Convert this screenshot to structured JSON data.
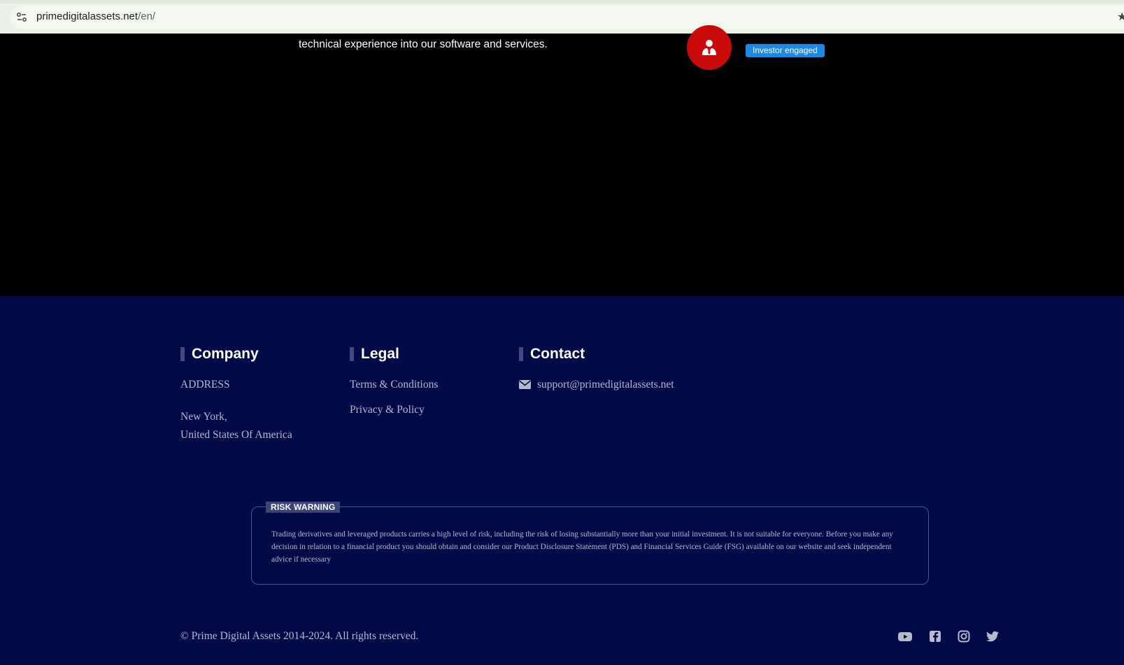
{
  "browser": {
    "url_domain": "primedigitalassets.net",
    "url_path": "/en/"
  },
  "hero": {
    "text": "technical experience into our software and services.",
    "badge": "Investor engaged",
    "avatar_icon": "user-tie-icon",
    "avatar_color": "#c80a0a",
    "badge_color": "#1e88e5"
  },
  "footer": {
    "background": "#000a46",
    "company": {
      "heading": "Company",
      "address_label": "ADDRESS",
      "address_line1": "New York,",
      "address_line2": "United States Of America"
    },
    "legal": {
      "heading": "Legal",
      "links": [
        "Terms & Conditions",
        "Privacy & Policy"
      ]
    },
    "contact": {
      "heading": "Contact",
      "email_icon": "envelope-icon",
      "email": "support@primedigitalassets.net"
    },
    "risk": {
      "label": "RISK WARNING",
      "text": "Trading derivatives and leveraged products carries a high level of risk, including the risk of losing substantially more than your initial investment. It is not suitable for everyone. Before you make any decision in relation to a financial product you should obtain and consider our Product Disclosure Statement (PDS) and Financial Services Guide (FSG) available on our website and seek independent advice if necessary"
    },
    "copyright": "© Prime Digital Assets 2014-2024. All rights reserved.",
    "social_icons": [
      "youtube-icon",
      "facebook-icon",
      "instagram-icon",
      "twitter-icon"
    ]
  }
}
